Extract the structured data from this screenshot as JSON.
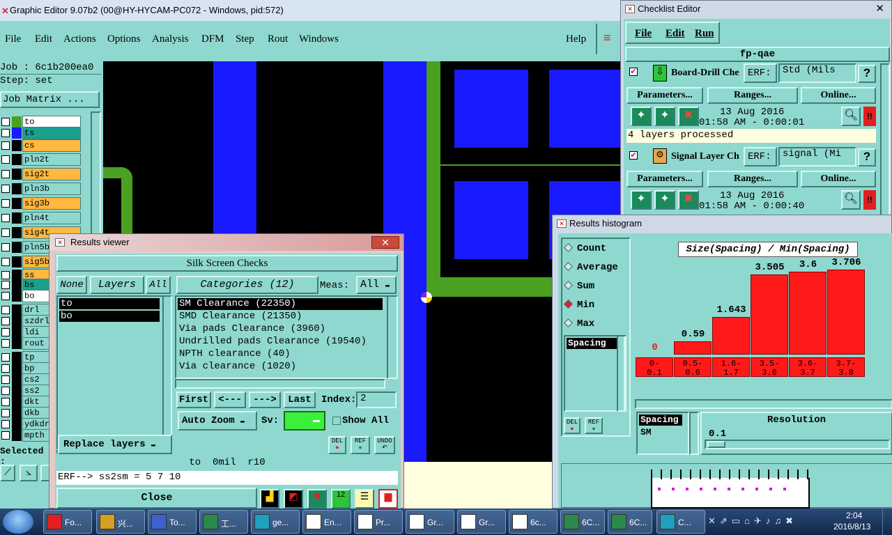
{
  "main_window": {
    "title": "Graphic Editor 9.07b2 (00@HY-HYCAM-PC072 - Windows, pid:572)",
    "menu": [
      "File",
      "Edit",
      "Actions",
      "Options",
      "Analysis",
      "DFM",
      "Step",
      "Rout",
      "Windows"
    ],
    "help": "Help",
    "job_label": "Job : 6c1b200ea0",
    "step_label": "Step: set",
    "job_matrix": "Job Matrix ...",
    "selected_label": "Selected :",
    "layers": [
      {
        "name": "to",
        "color": "#ffffff",
        "swatch": "#4aa020"
      },
      {
        "name": "ts",
        "color": "#1aa08f",
        "swatch": "#1a1aff"
      },
      {
        "name": "cs",
        "color": "#ffb840",
        "swatch": "#000000"
      },
      {
        "name": "pln2t",
        "color": "#8fd8cf",
        "swatch": "#000000"
      },
      {
        "name": "sig2t",
        "color": "#ffb840",
        "swatch": "#000000"
      },
      {
        "name": "pln3b",
        "color": "#8fd8cf",
        "swatch": "#000000"
      },
      {
        "name": "sig3b",
        "color": "#ffb840",
        "swatch": "#000000"
      },
      {
        "name": "pln4t",
        "color": "#8fd8cf",
        "swatch": "#000000"
      },
      {
        "name": "sig4t",
        "color": "#ffb840",
        "swatch": "#000000"
      },
      {
        "name": "pln5b",
        "color": "#8fd8cf",
        "swatch": "#000000"
      },
      {
        "name": "sig5b",
        "color": "#ffb840",
        "swatch": "#000000"
      },
      {
        "name": "ss",
        "color": "#ffb840",
        "swatch": "#000000"
      },
      {
        "name": "bs",
        "color": "#1aa08f",
        "swatch": "#000000"
      },
      {
        "name": "bo",
        "color": "#ffffff",
        "swatch": "#000000"
      },
      {
        "name": "drl",
        "color": "#8fd8cf",
        "swatch": "#000000"
      },
      {
        "name": "szdrl",
        "color": "#8fd8cf",
        "swatch": "#000000"
      },
      {
        "name": "ldi",
        "color": "#8fd8cf",
        "swatch": "#000000"
      },
      {
        "name": "rout",
        "color": "#8fd8cf",
        "swatch": "#000000"
      },
      {
        "name": "tp",
        "color": "#8fd8cf",
        "swatch": "#000000"
      },
      {
        "name": "bp",
        "color": "#8fd8cf",
        "swatch": "#000000"
      },
      {
        "name": "cs2",
        "color": "#8fd8cf",
        "swatch": "#000000"
      },
      {
        "name": "ss2",
        "color": "#8fd8cf",
        "swatch": "#000000"
      },
      {
        "name": "dkt",
        "color": "#8fd8cf",
        "swatch": "#000000"
      },
      {
        "name": "dkb",
        "color": "#8fd8cf",
        "swatch": "#000000"
      },
      {
        "name": "ydkdr",
        "color": "#8fd8cf",
        "swatch": "#000000"
      },
      {
        "name": "mpth",
        "color": "#8fd8cf",
        "swatch": "#000000"
      }
    ]
  },
  "checklist": {
    "title": "Checklist Editor",
    "menu": [
      "File",
      "Edit",
      "Run"
    ],
    "name": "fp-qae",
    "checks": [
      {
        "name": "Board-Drill Che",
        "erf": "ERF:",
        "erf_value": "Std (Mils",
        "parameters": "Parameters...",
        "ranges": "Ranges...",
        "online": "Online...",
        "date": "13 Aug 2016",
        "time": "01:58 AM - 0:00:01",
        "status": "4 layers processed"
      },
      {
        "name": "Signal Layer Ch",
        "erf": "ERF:",
        "erf_value": "signal (Mi",
        "parameters": "Parameters...",
        "ranges": "Ranges...",
        "online": "Online...",
        "date": "13 Aug 2016",
        "time": "01:58 AM - 0:00:40"
      }
    ],
    "help": "?",
    "alert": "!!"
  },
  "results_viewer": {
    "title": "Results viewer",
    "heading": "Silk Screen Checks",
    "none_btn": "None",
    "layers_btn": "Layers",
    "all_btn": "All",
    "categories_btn": "Categories (12)",
    "meas_label": "Meas:",
    "meas_value": "All",
    "layers": [
      "to",
      "bo"
    ],
    "categories": [
      "SM Clearance (22350)",
      "SMD Clearance (21350)",
      "Via pads Clearance (3960)",
      "Undrilled pads Clearance (19540)",
      "NPTH clearance (40)",
      "Via clearance (1020)"
    ],
    "nav": [
      "First",
      "<---",
      "--->",
      "Last"
    ],
    "index_label": "Index:",
    "index_value": "2",
    "auto_zoom": "Auto Zoom",
    "sv_label": "Sv:",
    "show_all": "Show All",
    "replace_layers": "Replace layers",
    "del": "DEL",
    "ref": "REF",
    "undo": "UNDO",
    "status": "to  0mil  r10",
    "erf_line": "ERF--> ss2sm = 5 7 10",
    "close": "Close"
  },
  "histogram": {
    "title": "Results histogram",
    "modes": [
      "Count",
      "Average",
      "Sum",
      "Min",
      "Max"
    ],
    "selected_mode": "Min",
    "chart_title": "Size(Spacing) / Min(Spacing)",
    "list_left": [
      "Spacing"
    ],
    "del": "DEL",
    "ref": "REF",
    "measure_list": [
      "Spacing",
      "SM"
    ],
    "resolution_label": "Resolution",
    "resolution_value": "0.1"
  },
  "chart_data": {
    "type": "bar",
    "title": "Size(Spacing) / Min(Spacing)",
    "categories": [
      "0-0.1",
      "0.5-0.6",
      "1.6-1.7",
      "3.5-3.6",
      "3.6-3.7",
      "3.7-3.8"
    ],
    "values": [
      0,
      0.59,
      1.643,
      3.505,
      3.6,
      3.706
    ],
    "value_labels": [
      "0",
      "0.59",
      "1.643",
      "3.505",
      "3.6",
      "3.706"
    ],
    "range_labels": [
      [
        "0-",
        "0.1"
      ],
      [
        "0.5-",
        "0.6"
      ],
      [
        "1.6-",
        "1.7"
      ],
      [
        "3.5-",
        "3.6"
      ],
      [
        "3.6-",
        "3.7"
      ],
      [
        "3.7-",
        "3.8"
      ]
    ],
    "ylim": [
      0,
      3.706
    ],
    "grid": false
  },
  "taskbar": {
    "items": [
      "Fo...",
      "兴...",
      "To...",
      "工...",
      "ge...",
      "En...",
      "Pr...",
      "Gr...",
      "Gr...",
      "6c...",
      "6C...",
      "6C...",
      "C..."
    ],
    "time": "2:04",
    "date": "2016/8/13"
  },
  "colors": {
    "teal": "#8fd8cf",
    "blue": "#1a1aff",
    "green": "#4aa020",
    "red": "#ff1a1a",
    "orange": "#ffb840"
  }
}
